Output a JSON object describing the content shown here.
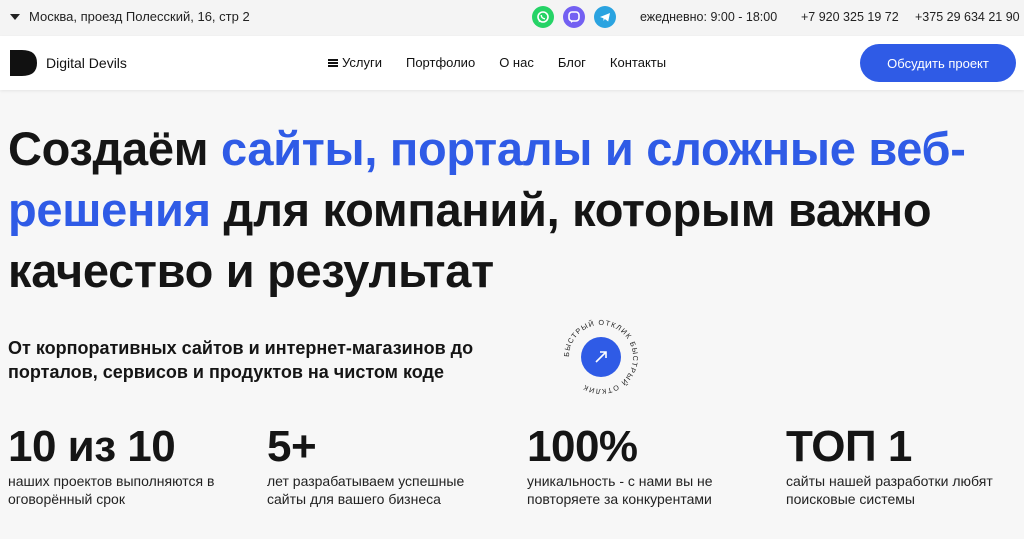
{
  "topbar": {
    "address": "Москва, проезд Полесский, 16, стр 2",
    "hours": "ежедневно: 9:00 - 18:00",
    "phone_ru": "+7 920 325 19 72",
    "phone_by": "+375 29 634 21 90",
    "messengers": [
      "whatsapp-icon",
      "viber-icon",
      "telegram-icon"
    ]
  },
  "nav": {
    "brand": "Digital Devils",
    "items": [
      "Услуги",
      "Портфолио",
      "О нас",
      "Блог",
      "Контакты"
    ],
    "cta": "Обсудить проект"
  },
  "hero": {
    "title_start": "Создаём ",
    "title_accent": "сайты, порталы и сложные веб-решения",
    "title_end": " для компаний, которым важно качество и результат",
    "subtitle": "От корпоративных сайтов и интернет-магазинов до порталов, сервисов и продуктов на чистом коде",
    "badge_text": "БЫСТРЫЙ ОТКЛИК БЫСТРЫЙ ОТКЛИК"
  },
  "stats": [
    {
      "value": "10 из 10",
      "desc": "наших проектов выполняются в оговорённый срок"
    },
    {
      "value": "5+",
      "desc": "лет разрабатываем успешные сайты для вашего бизнеса"
    },
    {
      "value": "100%",
      "desc": "уникальность - с нами вы не повторяете за конкурентами"
    },
    {
      "value": "ТОП 1",
      "desc": "сайты нашей разработки любят поисковые системы"
    }
  ],
  "colors": {
    "accent": "#2f5be6",
    "whatsapp": "#25d366",
    "viber": "#7360f2",
    "telegram": "#2aa3e0"
  }
}
